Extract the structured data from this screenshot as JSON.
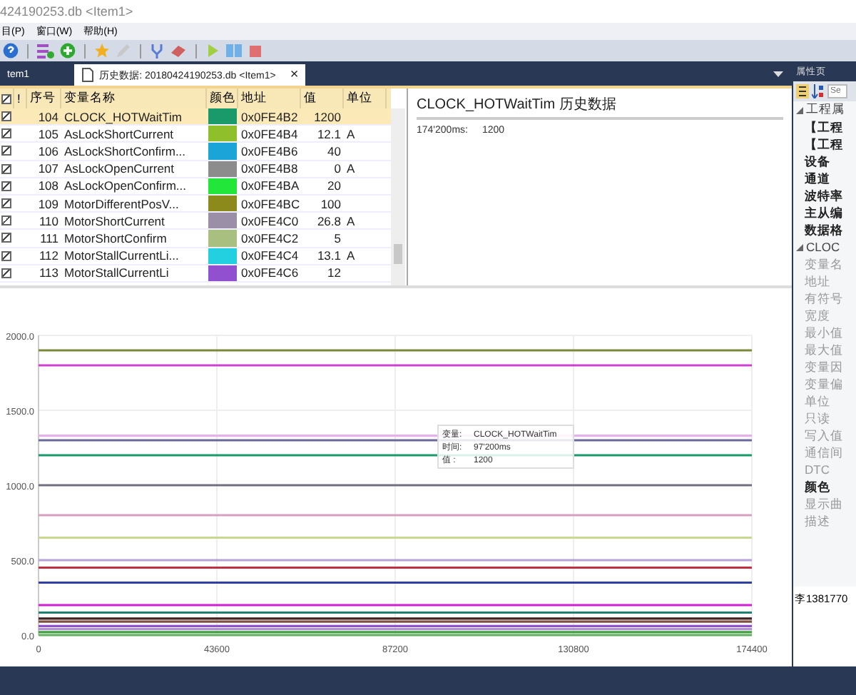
{
  "window": {
    "title": "424190253.db <Item1>"
  },
  "menu": [
    "目(P)",
    "窗口(W)",
    "帮助(H)"
  ],
  "tabs": [
    {
      "label": "tem1",
      "selected": false
    },
    {
      "label": "历史数据: 20180424190253.db <Item1>",
      "selected": true,
      "close": "×"
    }
  ],
  "table": {
    "columns": [
      "!",
      "序号",
      "变量名称",
      "颜色",
      "地址",
      "值",
      "单位"
    ],
    "header_checked": true,
    "rows": [
      {
        "checked": true,
        "selected": true,
        "no": "104",
        "name": "CLOCK_HOTWaitTim",
        "color": "#1a9a6a",
        "address": "0x0FE4B2",
        "value": "1200",
        "unit": ""
      },
      {
        "checked": true,
        "selected": false,
        "no": "105",
        "name": "AsLockShortCurrent",
        "color": "#8fbf2a",
        "address": "0x0FE4B4",
        "value": "12.1",
        "unit": "A"
      },
      {
        "checked": true,
        "selected": false,
        "no": "106",
        "name": "AsLockShortConfirm...",
        "color": "#1aa4d8",
        "address": "0x0FE4B6",
        "value": "40",
        "unit": ""
      },
      {
        "checked": true,
        "selected": false,
        "no": "107",
        "name": "AsLockOpenCurrent",
        "color": "#8c8c8c",
        "address": "0x0FE4B8",
        "value": "0",
        "unit": "A"
      },
      {
        "checked": true,
        "selected": false,
        "no": "108",
        "name": "AsLockOpenConfirm...",
        "color": "#22e63a",
        "address": "0x0FE4BA",
        "value": "20",
        "unit": ""
      },
      {
        "checked": true,
        "selected": false,
        "no": "109",
        "name": "MotorDifferentPosV...",
        "color": "#8c8a1a",
        "address": "0x0FE4BC",
        "value": "100",
        "unit": ""
      },
      {
        "checked": true,
        "selected": false,
        "no": "110",
        "name": "MotorShortCurrent",
        "color": "#9a8fa6",
        "address": "0x0FE4C0",
        "value": "26.8",
        "unit": "A"
      },
      {
        "checked": true,
        "selected": false,
        "no": "111",
        "name": "MotorShortConfirm",
        "color": "#a8bf80",
        "address": "0x0FE4C2",
        "value": "5",
        "unit": ""
      },
      {
        "checked": true,
        "selected": false,
        "no": "112",
        "name": "MotorStallCurrentLi...",
        "color": "#22d0e0",
        "address": "0x0FE4C4",
        "value": "13.1",
        "unit": "A"
      },
      {
        "checked": true,
        "selected": false,
        "no": "113",
        "name": "MotorStallCurrentLi",
        "color": "#9050d0",
        "address": "0x0FE4C6",
        "value": "12",
        "unit": ""
      }
    ]
  },
  "history": {
    "title": "CLOCK_HOTWaitTim  历史数据",
    "entries": [
      {
        "time": "174'200ms:",
        "value": "1200"
      }
    ]
  },
  "chart": {
    "tooltip": [
      {
        "label": "变量:",
        "value": "CLOCK_HOTWaitTim"
      },
      {
        "label": "时间:",
        "value": "97'200ms"
      },
      {
        "label": "值 :",
        "value": "1200"
      }
    ],
    "chart_data": {
      "type": "line",
      "grid": true,
      "x": [
        0,
        174400
      ],
      "xlim": [
        0,
        174400
      ],
      "ylim": [
        0,
        2000
      ],
      "xticks": [
        0,
        43600,
        87200,
        130800,
        174400
      ],
      "yticks": [
        {
          "value": 0,
          "label": "0.0"
        },
        {
          "value": 500,
          "label": "500.0"
        },
        {
          "value": 1000,
          "label": "1000.0"
        },
        {
          "value": 1500,
          "label": "1500.0"
        },
        {
          "value": 2000,
          "label": "2000.0"
        }
      ],
      "series": [
        {
          "color": "#7a8a3a",
          "values": [
            1900,
            1900
          ]
        },
        {
          "color": "#d040d0",
          "values": [
            1800,
            1800
          ]
        },
        {
          "color": "#e8b0e8",
          "values": [
            1330,
            1330
          ]
        },
        {
          "color": "#6a6a9a",
          "values": [
            1300,
            1300
          ]
        },
        {
          "color": "#1a9a6a",
          "values": [
            1200,
            1200
          ]
        },
        {
          "color": "#707080",
          "values": [
            1000,
            1000
          ]
        },
        {
          "color": "#d8a0c0",
          "values": [
            800,
            800
          ]
        },
        {
          "color": "#c8d890",
          "values": [
            650,
            650
          ]
        },
        {
          "color": "#b8a0d8",
          "values": [
            500,
            500
          ]
        },
        {
          "color": "#c03040",
          "values": [
            450,
            450
          ]
        },
        {
          "color": "#3040a0",
          "values": [
            350,
            350
          ]
        },
        {
          "color": "#d020d0",
          "values": [
            200,
            200
          ]
        },
        {
          "color": "#208070",
          "values": [
            150,
            150
          ]
        },
        {
          "color": "#402020",
          "values": [
            110,
            110
          ]
        },
        {
          "color": "#805040",
          "values": [
            90,
            90
          ]
        },
        {
          "color": "#9050d0",
          "values": [
            60,
            60
          ]
        },
        {
          "color": "#b090d0",
          "values": [
            40,
            40
          ]
        },
        {
          "color": "#40a040",
          "values": [
            20,
            20
          ]
        },
        {
          "color": "#60b060",
          "values": [
            0,
            0
          ]
        }
      ]
    }
  },
  "properties": {
    "title": "属性页",
    "search": {
      "placeholder": "Se"
    },
    "items": [
      {
        "kind": "group",
        "label": "工程属",
        "expanded": true
      },
      {
        "kind": "item",
        "label": "【工程",
        "disabled": false
      },
      {
        "kind": "item",
        "label": "【工程",
        "disabled": false
      },
      {
        "kind": "item",
        "label": "设备",
        "disabled": false
      },
      {
        "kind": "item",
        "label": "通道",
        "disabled": false
      },
      {
        "kind": "item",
        "label": "波特率",
        "disabled": false
      },
      {
        "kind": "item",
        "label": "主从编",
        "disabled": false
      },
      {
        "kind": "item",
        "label": "数据格",
        "disabled": false
      },
      {
        "kind": "group",
        "label": "CLOC",
        "expanded": true
      },
      {
        "kind": "item",
        "label": "变量名",
        "disabled": true
      },
      {
        "kind": "item",
        "label": "地址",
        "disabled": true
      },
      {
        "kind": "item",
        "label": "有符号",
        "disabled": true
      },
      {
        "kind": "item",
        "label": "宽度",
        "disabled": true
      },
      {
        "kind": "item",
        "label": "最小值",
        "disabled": true
      },
      {
        "kind": "item",
        "label": "最大值",
        "disabled": true
      },
      {
        "kind": "item",
        "label": "变量因",
        "disabled": true
      },
      {
        "kind": "item",
        "label": "变量偏",
        "disabled": true
      },
      {
        "kind": "item",
        "label": "单位",
        "disabled": true
      },
      {
        "kind": "item",
        "label": "只读",
        "disabled": true
      },
      {
        "kind": "item",
        "label": "写入值",
        "disabled": true
      },
      {
        "kind": "item",
        "label": "通信间",
        "disabled": true
      },
      {
        "kind": "item",
        "label": "DTC",
        "disabled": true
      },
      {
        "kind": "item",
        "label": "颜色",
        "disabled": false
      },
      {
        "kind": "item",
        "label": "显示曲",
        "disabled": true
      },
      {
        "kind": "item",
        "label": "描述",
        "disabled": true
      }
    ],
    "description": "李1381770"
  }
}
